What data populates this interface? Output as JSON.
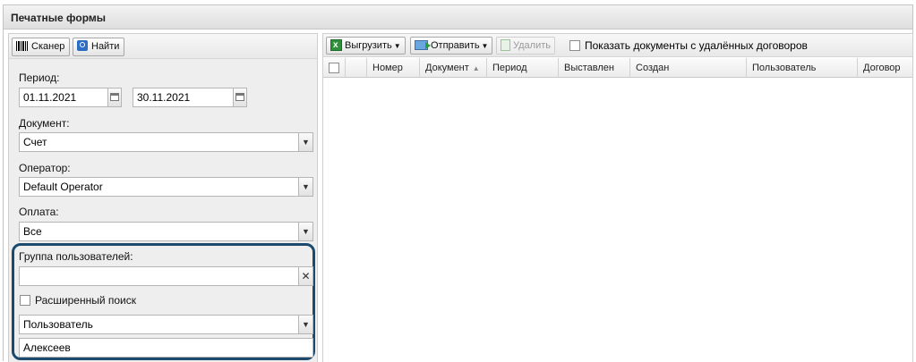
{
  "window": {
    "title": "Печатные формы"
  },
  "left_toolbar": {
    "scanner_label": "Сканер",
    "find_label": "Найти"
  },
  "filters": {
    "period_label": "Период:",
    "period_from": "01.11.2021",
    "period_to": "30.11.2021",
    "document_label": "Документ:",
    "document_value": "Счет",
    "operator_label": "Оператор:",
    "operator_value": "Default Operator",
    "payment_label": "Оплата:",
    "payment_value": "Все",
    "user_group_label": "Группа пользователей:",
    "user_group_value": "",
    "extended_search_label": "Расширенный поиск",
    "extended_search_checked": false,
    "search_field_value": "Пользователь",
    "search_text_value": "Алексеев"
  },
  "right_toolbar": {
    "export_label": "Выгрузить",
    "send_label": "Отправить",
    "delete_label": "Удалить",
    "show_deleted_label": "Показать документы с удалённых договоров",
    "show_deleted_checked": false
  },
  "grid": {
    "columns": [
      "",
      "Номер",
      "Документ",
      "Период",
      "Выставлен",
      "Создан",
      "Пользователь",
      "Договор"
    ],
    "sorted_column": "Документ",
    "sort_direction": "asc",
    "rows": []
  },
  "colors": {
    "highlight_border": "#1b4a6e",
    "header_bg": "#e6e6e6"
  },
  "icons": {
    "scanner": "barcode-icon",
    "find": "search-icon",
    "export": "excel-icon",
    "send": "send-icon",
    "delete": "delete-icon",
    "calendar": "calendar-icon",
    "dropdown": "chevron-down-icon",
    "clear": "close-icon"
  }
}
